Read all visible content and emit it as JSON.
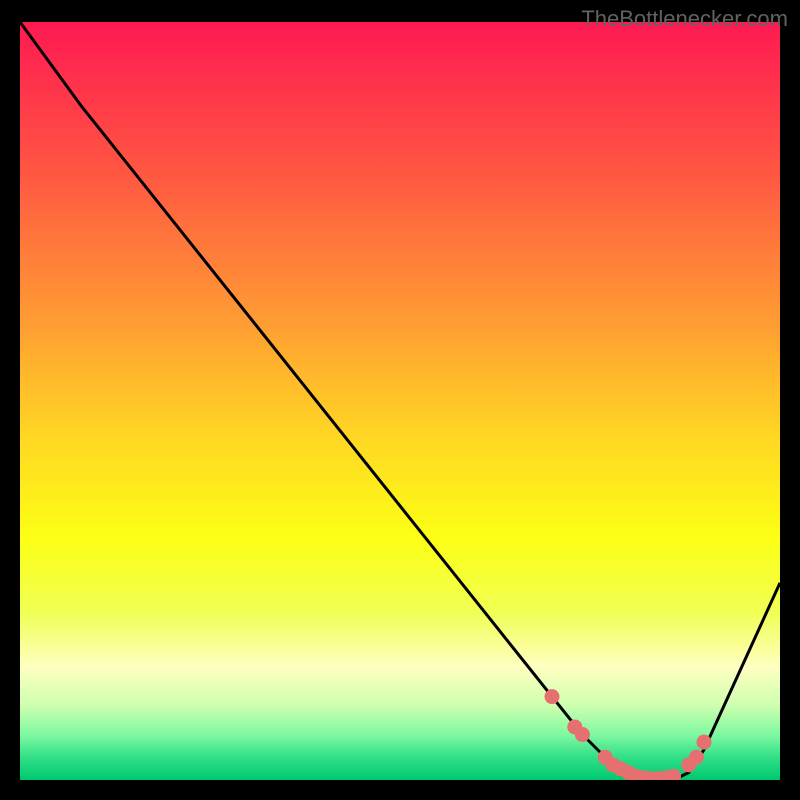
{
  "watermark": "TheBottlenecker.com",
  "chart_data": {
    "type": "line",
    "title": "",
    "xlabel": "",
    "ylabel": "",
    "xlim": [
      0,
      100
    ],
    "ylim": [
      0,
      100
    ],
    "series": [
      {
        "name": "curve",
        "x": [
          0,
          8,
          70,
          74,
          77,
          80,
          83,
          86,
          88,
          90,
          100
        ],
        "y": [
          100,
          89,
          11,
          6,
          3,
          1,
          0,
          0,
          1,
          4,
          26
        ]
      }
    ],
    "scatter_points": {
      "x": [
        70,
        73,
        74,
        77,
        78,
        79,
        80,
        81,
        82,
        83,
        84,
        85,
        86,
        88,
        89,
        90
      ],
      "y": [
        11,
        7,
        6,
        3,
        2,
        1.5,
        1,
        0.5,
        0.3,
        0.2,
        0.2,
        0.3,
        0.5,
        2,
        3,
        5
      ]
    },
    "gradient_stops": [
      {
        "offset": 0,
        "color": "#ff1952"
      },
      {
        "offset": 20,
        "color": "#ff5742"
      },
      {
        "offset": 40,
        "color": "#ff9e33"
      },
      {
        "offset": 55,
        "color": "#ffd823"
      },
      {
        "offset": 68,
        "color": "#fcff14"
      },
      {
        "offset": 78,
        "color": "#f0ff55"
      },
      {
        "offset": 85,
        "color": "#ffffc0"
      },
      {
        "offset": 90,
        "color": "#d0ffb0"
      },
      {
        "offset": 94,
        "color": "#80f8a0"
      },
      {
        "offset": 97,
        "color": "#30e088"
      },
      {
        "offset": 100,
        "color": "#00c870"
      }
    ],
    "dot_color": "#e67070",
    "curve_color": "#000000"
  }
}
